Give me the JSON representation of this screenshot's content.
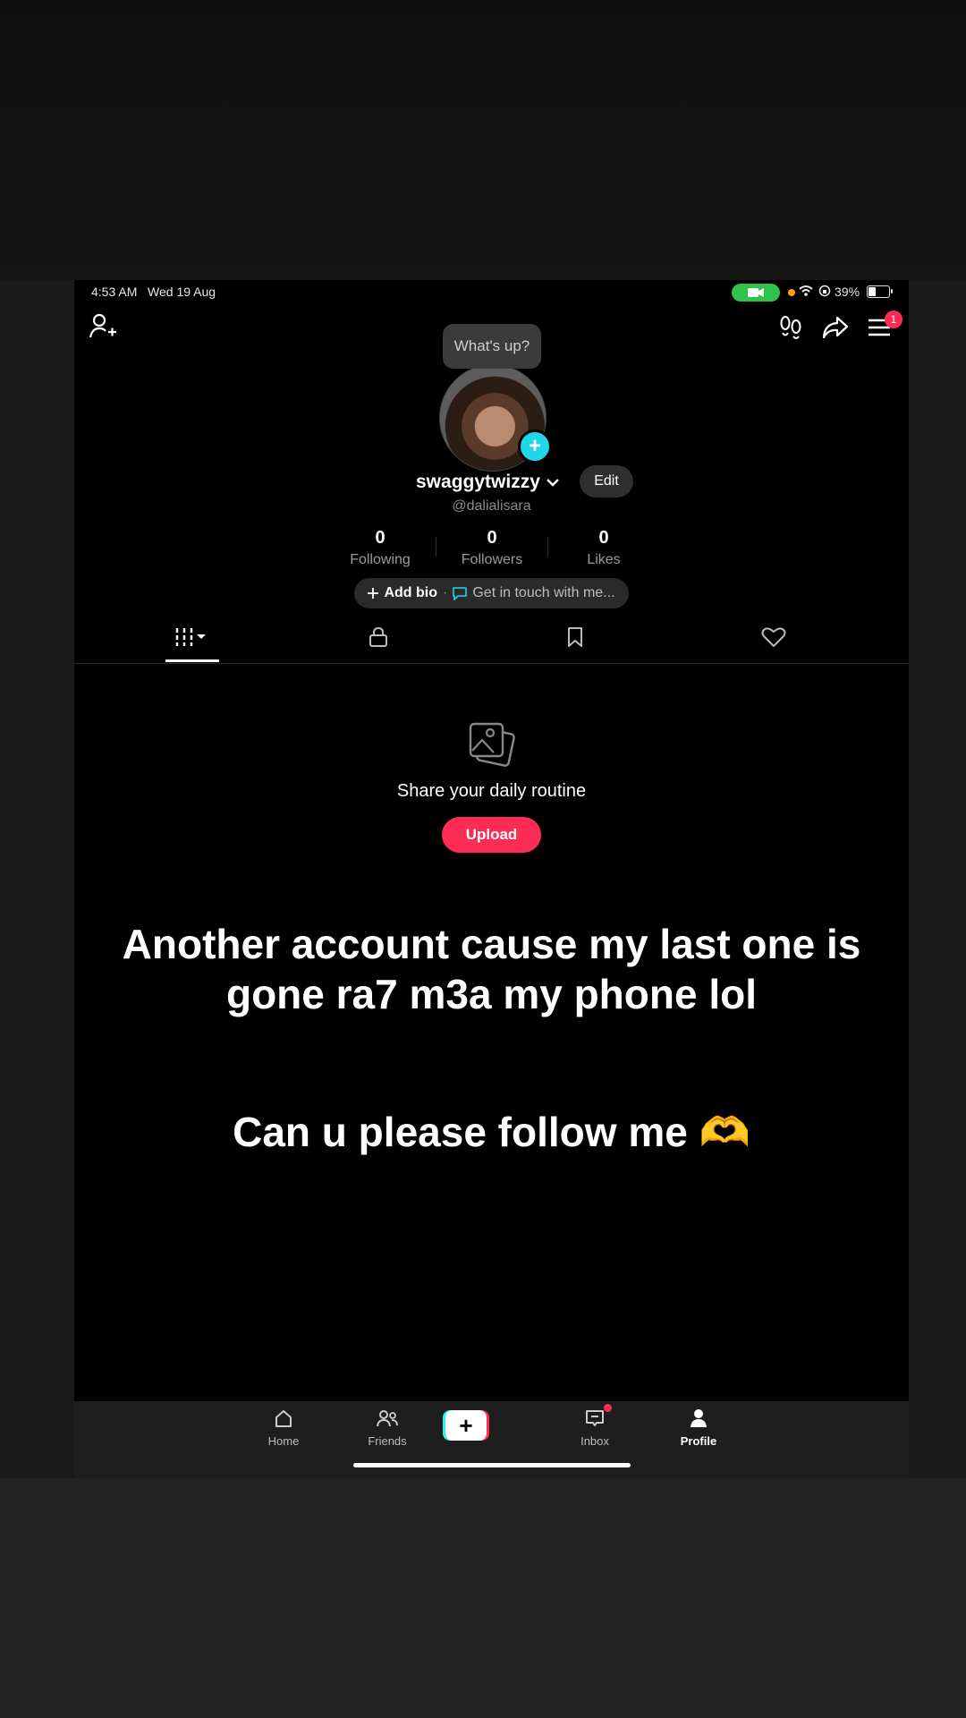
{
  "status_bar": {
    "time": "4:53 AM",
    "date": "Wed 19 Aug",
    "battery": "39%",
    "battery_level": 0.39,
    "camera_pill_color": "#30c34b"
  },
  "header": {
    "add_friend_icon": "add-person-icon",
    "visits_icon": "footprints-icon",
    "share_icon": "share-arrow-icon",
    "menu_icon": "hamburger-menu-icon",
    "menu_badge": "1"
  },
  "profile": {
    "status_bubble": "What's up?",
    "username": "swaggytwizzy",
    "handle": "@dalialisara",
    "edit_label": "Edit",
    "stats": [
      {
        "value": "0",
        "label": "Following"
      },
      {
        "value": "0",
        "label": "Followers"
      },
      {
        "value": "0",
        "label": "Likes"
      }
    ],
    "add_bio": "Add bio",
    "separator": "·",
    "contact": "Get in touch with me..."
  },
  "tabs": [
    "videos-grid-icon",
    "lock-icon",
    "bookmark-icon",
    "heart-icon"
  ],
  "empty_state": {
    "title": "Share your daily routine",
    "upload_label": "Upload"
  },
  "overlay_text": {
    "line1": "Another account cause my last one is gone ra7 m3a my phone lol",
    "line2": "Can u please follow me 🫶"
  },
  "nav": {
    "home": "Home",
    "friends": "Friends",
    "create": "+",
    "inbox": "Inbox",
    "profile": "Profile"
  },
  "colors": {
    "accent": "#fe2c55",
    "cyan": "#20d5ec",
    "background": "#000000"
  }
}
